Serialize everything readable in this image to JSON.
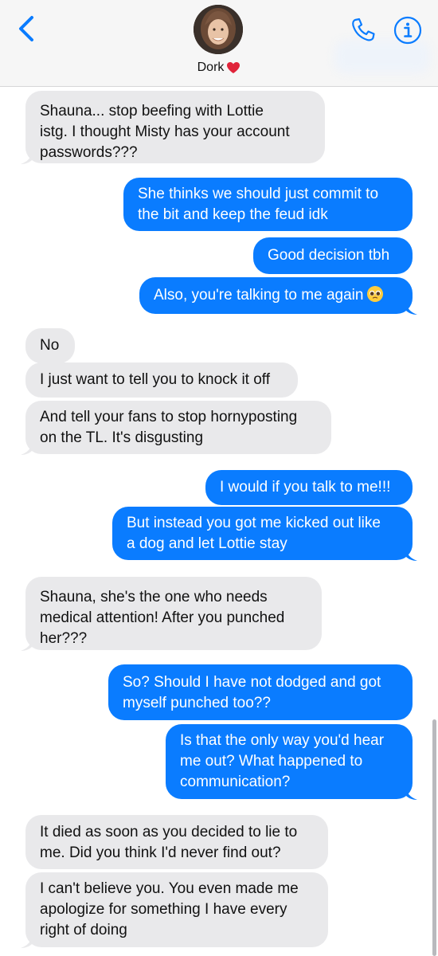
{
  "header": {
    "contact_name": "Dork",
    "icons": {
      "back": "chevron-left-icon",
      "phone": "phone-icon",
      "info": "info-icon",
      "heart": "red-heart-emoji"
    },
    "accent_color": "#0a7cff"
  },
  "colors": {
    "sent_bubble": "#0a7cff",
    "received_bubble": "#e9e9eb",
    "header_bg": "#f6f6f6"
  },
  "messages": [
    {
      "from": "them",
      "lines": [
        "Shauna... stop beefing with Lottie",
        "istg. I thought Misty has your account",
        "passwords???"
      ]
    },
    {
      "from": "me",
      "lines": [
        "She thinks we should just commit to",
        "the bit and keep the feud idk"
      ]
    },
    {
      "from": "me",
      "lines": [
        "Good decision tbh"
      ]
    },
    {
      "from": "me",
      "lines": [
        "Also, you're talking to me again"
      ],
      "emoji": "pleading-face-emoji"
    },
    {
      "from": "them",
      "lines": [
        "No"
      ]
    },
    {
      "from": "them",
      "lines": [
        "I just want to tell you to knock it off"
      ]
    },
    {
      "from": "them",
      "lines": [
        "And tell your fans to stop hornyposting",
        "on the TL. It's disgusting"
      ]
    },
    {
      "from": "me",
      "lines": [
        "I would if you talk to me!!!"
      ]
    },
    {
      "from": "me",
      "lines": [
        "But instead you got me kicked out like",
        "a dog and let Lottie stay"
      ]
    },
    {
      "from": "them",
      "lines": [
        "Shauna, she's the one who needs",
        "medical attention! After you punched",
        "her???"
      ]
    },
    {
      "from": "me",
      "lines": [
        "So? Should I have not dodged and got",
        "myself punched too??"
      ]
    },
    {
      "from": "me",
      "lines": [
        "Is that the only way you'd hear",
        "me out? What happened to",
        "communication?"
      ]
    },
    {
      "from": "them",
      "lines": [
        "It died as soon as you decided to lie to",
        "me.  Did you think I'd never find out?"
      ]
    },
    {
      "from": "them",
      "lines": [
        "I can't believe you. You even made me",
        "apologize for something I have every",
        "right of doing"
      ]
    }
  ]
}
